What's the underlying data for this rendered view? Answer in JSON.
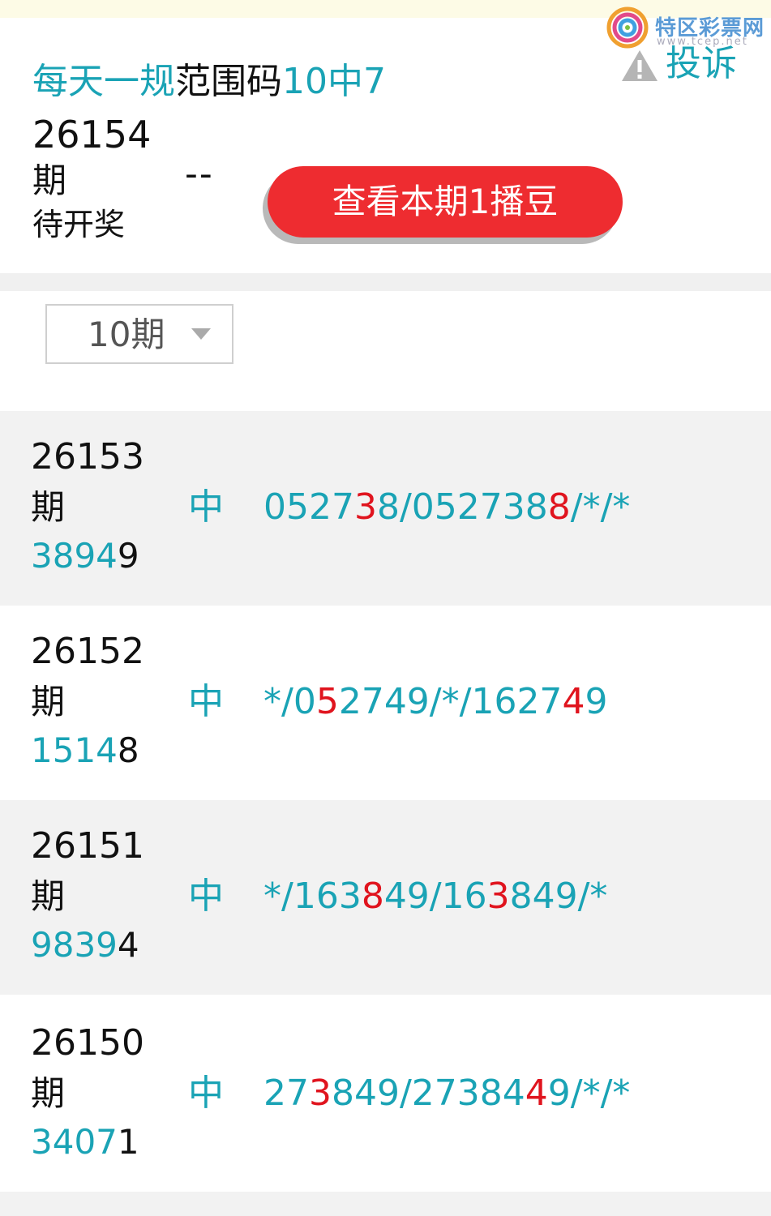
{
  "header": {
    "title_part1": "每天一规",
    "title_part2": "范围码",
    "title_part3": "10中7",
    "logo_name": "特区彩票网",
    "logo_url": "www.tcep.net",
    "complain_label": "投诉",
    "complain_icon": "warning-icon"
  },
  "current": {
    "issue": "26154",
    "qi": "期",
    "status": "待开奖",
    "dash": "--",
    "button_label": "查看本期1播豆"
  },
  "filter": {
    "selected": "10期"
  },
  "rows": [
    {
      "issue": "26153",
      "qi": "期",
      "result_teal": "3894",
      "result_dark": "9",
      "hit": "中",
      "pred": [
        {
          "t": "0527",
          "c": "teal"
        },
        {
          "t": "3",
          "c": "red"
        },
        {
          "t": "8/052738",
          "c": "teal"
        },
        {
          "t": "8",
          "c": "red"
        },
        {
          "t": "/*/*",
          "c": "teal"
        }
      ]
    },
    {
      "issue": "26152",
      "qi": "期",
      "result_teal": "1514",
      "result_dark": "8",
      "hit": "中",
      "pred": [
        {
          "t": "*/0",
          "c": "teal"
        },
        {
          "t": "5",
          "c": "red"
        },
        {
          "t": "2749/*/1627",
          "c": "teal"
        },
        {
          "t": "4",
          "c": "red"
        },
        {
          "t": "9",
          "c": "teal"
        }
      ]
    },
    {
      "issue": "26151",
      "qi": "期",
      "result_teal": "9839",
      "result_dark": "4",
      "hit": "中",
      "pred": [
        {
          "t": "*/163",
          "c": "teal"
        },
        {
          "t": "8",
          "c": "red"
        },
        {
          "t": "49/16",
          "c": "teal"
        },
        {
          "t": "3",
          "c": "red"
        },
        {
          "t": "849/*",
          "c": "teal"
        }
      ]
    },
    {
      "issue": "26150",
      "qi": "期",
      "result_teal": "3407",
      "result_dark": "1",
      "hit": "中",
      "pred": [
        {
          "t": "27",
          "c": "teal"
        },
        {
          "t": "3",
          "c": "red"
        },
        {
          "t": "849/27384",
          "c": "teal"
        },
        {
          "t": "4",
          "c": "red"
        },
        {
          "t": "9/*/*",
          "c": "teal"
        }
      ]
    }
  ],
  "colors": {
    "teal": "#1aa3b5",
    "red": "#e0141e",
    "button": "#ee2c30"
  }
}
